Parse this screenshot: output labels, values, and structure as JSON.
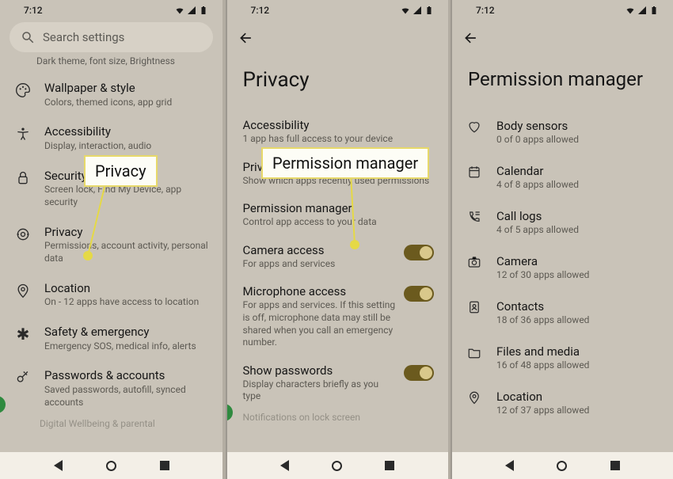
{
  "status": {
    "time": "7:12"
  },
  "screen1": {
    "search_placeholder": "Search settings",
    "cutoff_text": "Dark theme, font size, Brightness",
    "items": [
      {
        "title": "Wallpaper & style",
        "sub": "Colors, themed icons, app grid"
      },
      {
        "title": "Accessibility",
        "sub": "Display, interaction, audio"
      },
      {
        "title": "Security",
        "sub": "Screen lock, Find My Device, app security"
      },
      {
        "title": "Privacy",
        "sub": "Permissions, account activity, personal data"
      },
      {
        "title": "Location",
        "sub": "On - 12 apps have access to location"
      },
      {
        "title": "Safety & emergency",
        "sub": "Emergency SOS, medical info, alerts"
      },
      {
        "title": "Passwords & accounts",
        "sub": "Saved passwords, autofill, synced accounts"
      }
    ],
    "fade": "Digital Wellbeing & parental"
  },
  "screen2": {
    "title": "Privacy",
    "items": [
      {
        "title": "Accessibility",
        "sub": "1 app has full access to your device"
      },
      {
        "title": "Privacy dashboard",
        "sub": "Show which apps recently used permissions"
      },
      {
        "title": "Permission manager",
        "sub": "Control app access to your data"
      },
      {
        "title": "Camera access",
        "sub": "For apps and services",
        "toggle": true
      },
      {
        "title": "Microphone access",
        "sub": "For apps and services. If this setting is off, microphone data may still be shared when you call an emergency number.",
        "toggle": true
      },
      {
        "title": "Show passwords",
        "sub": "Display characters briefly as you type",
        "toggle": true
      }
    ],
    "fade": "Notifications on lock screen"
  },
  "screen3": {
    "title": "Permission manager",
    "items": [
      {
        "title": "Body sensors",
        "sub": "0 of 0 apps allowed"
      },
      {
        "title": "Calendar",
        "sub": "4 of 8 apps allowed"
      },
      {
        "title": "Call logs",
        "sub": "4 of 5 apps allowed"
      },
      {
        "title": "Camera",
        "sub": "12 of 30 apps allowed"
      },
      {
        "title": "Contacts",
        "sub": "18 of 36 apps allowed"
      },
      {
        "title": "Files and media",
        "sub": "16 of 48 apps allowed"
      },
      {
        "title": "Location",
        "sub": "12 of 37 apps allowed"
      }
    ]
  },
  "callouts": {
    "c1": "Privacy",
    "c2": "Permission manager"
  }
}
